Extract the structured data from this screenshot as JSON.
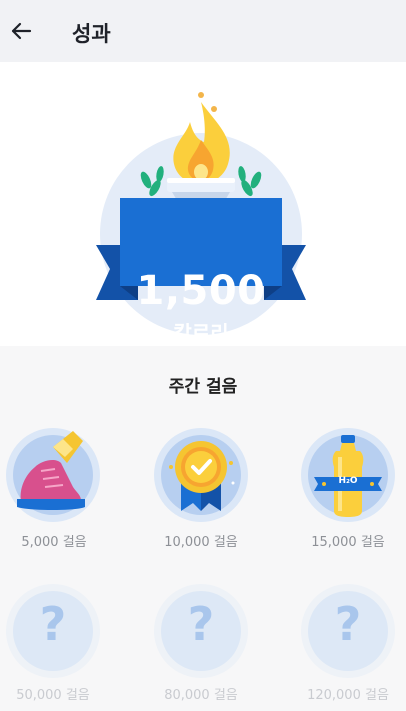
{
  "header": {
    "title": "성과"
  },
  "hero": {
    "value": "1,500",
    "unit": "칼로리"
  },
  "section": {
    "title": "주간 걸음"
  },
  "badges": [
    {
      "label": "5,000 걸음",
      "icon": "sneaker-icon",
      "locked": false
    },
    {
      "label": "10,000 걸음",
      "icon": "medal-icon",
      "locked": false
    },
    {
      "label": "15,000 걸음",
      "icon": "water-bottle-icon",
      "locked": false,
      "bottle_text": "H₂O"
    },
    {
      "label": "50,000 걸음",
      "icon": "question-icon",
      "locked": true,
      "glyph": "?"
    },
    {
      "label": "80,000 걸음",
      "icon": "question-icon",
      "locked": true,
      "glyph": "?"
    },
    {
      "label": "120,000 걸음",
      "icon": "question-icon",
      "locked": true,
      "glyph": "?"
    }
  ],
  "colors": {
    "brand_blue": "#1a6fd3",
    "ribbon_dark": "#1352a8",
    "badge_bg": "#dbe7f7",
    "flame": "#fbcf3c",
    "locked_glyph": "#a9c6ec"
  }
}
